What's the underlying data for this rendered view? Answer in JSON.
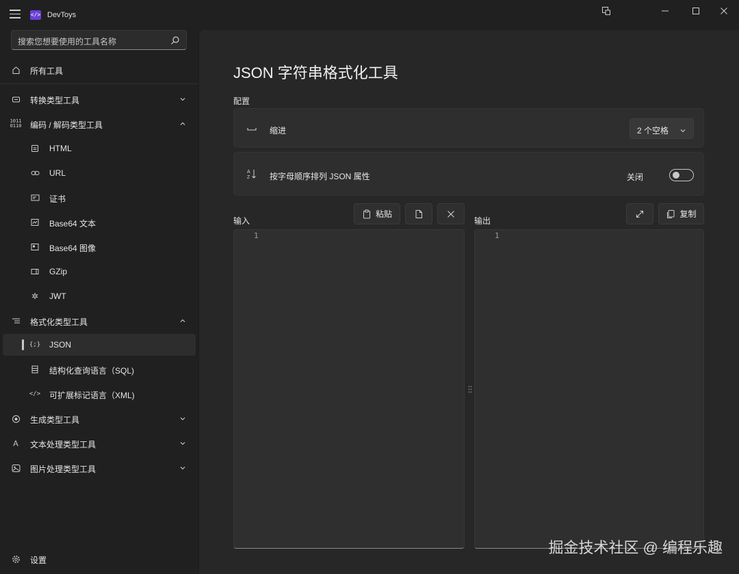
{
  "app": {
    "title": "DevToys",
    "logo_text": "</>"
  },
  "search": {
    "placeholder": "搜索您想要使用的工具名称"
  },
  "sidebar": {
    "items": [
      {
        "label": "所有工具",
        "icon": "home-icon"
      },
      {
        "label": "转换类型工具",
        "icon": "converter-icon",
        "expanded": false
      },
      {
        "label": "编码 / 解码类型工具",
        "icon": "binary-icon",
        "expanded": true
      },
      {
        "label": "HTML",
        "icon": "html-icon"
      },
      {
        "label": "URL",
        "icon": "link-icon"
      },
      {
        "label": "证书",
        "icon": "certificate-icon"
      },
      {
        "label": "Base64 文本",
        "icon": "base64-text-icon"
      },
      {
        "label": "Base64 图像",
        "icon": "base64-image-icon"
      },
      {
        "label": "GZip",
        "icon": "gzip-icon"
      },
      {
        "label": "JWT",
        "icon": "jwt-icon"
      },
      {
        "label": "格式化类型工具",
        "icon": "formatter-icon",
        "expanded": true
      },
      {
        "label": "JSON",
        "icon": "json-icon",
        "selected": true
      },
      {
        "label": "结构化查询语言（SQL)",
        "icon": "sql-icon"
      },
      {
        "label": "可扩展标记语言（XML)",
        "icon": "xml-icon"
      },
      {
        "label": "生成类型工具",
        "icon": "generator-icon",
        "expanded": false
      },
      {
        "label": "文本处理类型工具",
        "icon": "text-icon",
        "expanded": false
      },
      {
        "label": "图片处理类型工具",
        "icon": "image-icon",
        "expanded": false
      }
    ],
    "settings_label": "设置"
  },
  "main": {
    "title": "JSON 字符串格式化工具",
    "config_label": "配置",
    "indent": {
      "label": "缩进",
      "value": "2 个空格"
    },
    "sort": {
      "label": "按字母顺序排列 JSON 属性",
      "toggle_label": "关闭",
      "on": false
    },
    "input": {
      "label": "输入",
      "paste_label": "粘贴",
      "line_number": "1"
    },
    "output": {
      "label": "输出",
      "copy_label": "复制",
      "line_number": "1"
    }
  },
  "watermark": "掘金技术社区 @ 编程乐趣",
  "colors": {
    "background": "#202020",
    "content": "#272727",
    "accent": "#6b3fd6"
  }
}
